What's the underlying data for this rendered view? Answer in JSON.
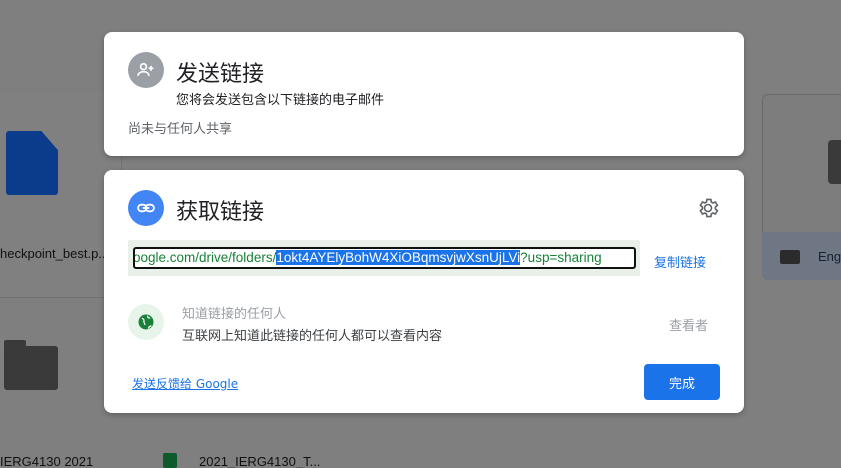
{
  "background": {
    "file_label": "heckpoint_best.p...",
    "folder_label": "IERG4130 2021",
    "sheet_label": "2021_IERG4130_T...",
    "right_label": "Eng"
  },
  "send_dialog": {
    "title": "发送链接",
    "subtitle": "您将会发送包含以下链接的电子邮件",
    "share_status": "尚未与任何人共享",
    "icon": "person-add-icon"
  },
  "link_dialog": {
    "title": "获取链接",
    "icon": "link-icon",
    "settings_icon": "gear-icon",
    "link_prefix": "oogle.com/drive/folders/",
    "link_selected": "1okt4AYElyBohW4XiOBqmsvjwXsnUjLVi",
    "link_suffix": "?usp=sharing",
    "copy_label": "复制链接",
    "access_title": "知道链接的任何人",
    "access_desc": "互联网上知道此链接的任何人都可以查看内容",
    "role": "查看者",
    "feedback": "发送反馈给 Google",
    "done": "完成"
  },
  "colors": {
    "accent": "#1a73e8",
    "link_text": "#188038",
    "overlay": "#808080"
  }
}
